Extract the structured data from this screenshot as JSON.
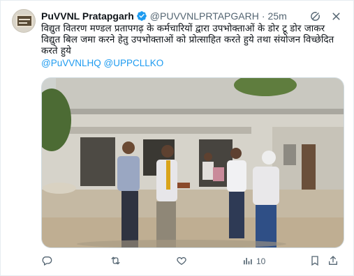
{
  "tweet": {
    "display_name": "PuVVNL Pratapgarh",
    "handle": "@PUVVNLPRTAPGARH",
    "separator": "·",
    "time": "25m",
    "text": "विद्युत वितरण मण्डल प्रतापगढ़ के कर्मचारियों द्वारा उपभोक्ताओं के डोर टू डोर जाकर विद्युत बिल जमा करने हेतु उपभोक्ताओं को प्रोत्साहित करते हुये तथा संयोजन विच्छेदित करते हुये",
    "mentions": [
      "@PuVVNLHQ",
      "@UPPCLLKO"
    ],
    "views_count": "10"
  },
  "icons": {
    "verified": "verified-badge-icon",
    "grok": "grok-icon",
    "more": "more-icon",
    "reply": "reply-icon",
    "retweet": "retweet-icon",
    "like": "like-icon",
    "views": "views-icon",
    "bookmark": "bookmark-icon",
    "share": "share-icon"
  },
  "colors": {
    "accent": "#1d9bf0",
    "muted": "#536471",
    "text": "#0f1419"
  }
}
